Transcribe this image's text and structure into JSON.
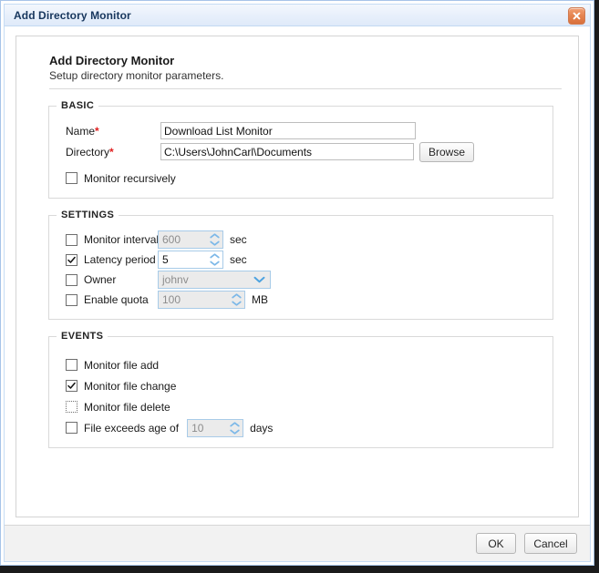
{
  "window": {
    "title": "Add Directory Monitor",
    "close_icon": "close-icon"
  },
  "header": {
    "title": "Add Directory Monitor",
    "subtitle": "Setup directory monitor parameters."
  },
  "basic": {
    "legend": "BASIC",
    "name_label": "Name",
    "name_required": "*",
    "name_value": "Download List Monitor",
    "directory_label": "Directory",
    "directory_required": "*",
    "directory_value": "C:\\Users\\JohnCarl\\Documents",
    "browse_label": "Browse",
    "recursive_label": "Monitor recursively",
    "recursive_checked": false
  },
  "settings": {
    "legend": "SETTINGS",
    "monitor_interval": {
      "label": "Monitor interval",
      "checked": false,
      "value": "600",
      "unit": "sec",
      "disabled": true
    },
    "latency_period": {
      "label": "Latency period",
      "checked": true,
      "value": "5",
      "unit": "sec",
      "disabled": false
    },
    "owner": {
      "label": "Owner",
      "checked": false,
      "value": "johnv",
      "disabled": true,
      "chevron_icon": "chevron-down-icon"
    },
    "enable_quota": {
      "label": "Enable quota",
      "checked": false,
      "value": "100",
      "unit": "MB",
      "disabled": true
    }
  },
  "events": {
    "legend": "EVENTS",
    "file_add": {
      "label": "Monitor file add",
      "checked": false
    },
    "file_change": {
      "label": "Monitor file change",
      "checked": true
    },
    "file_delete": {
      "label": "Monitor file delete",
      "checked": false,
      "focused": true
    },
    "file_age": {
      "label": "File exceeds age of",
      "checked": false,
      "value": "10",
      "unit": "days",
      "disabled": true
    }
  },
  "footer": {
    "ok_label": "OK",
    "cancel_label": "Cancel"
  },
  "colors": {
    "title_text": "#17365d",
    "required_star": "#e02020",
    "close_button": "#e5834f",
    "spinner_border": "#a8cbe8",
    "disabled_bg": "#ebebeb",
    "disabled_text": "#8d8d8d"
  }
}
